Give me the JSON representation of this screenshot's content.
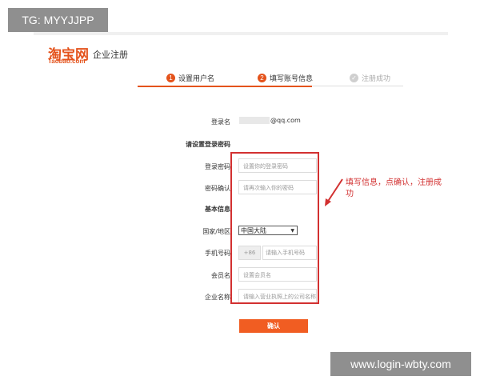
{
  "watermarks": {
    "top": "TG: MYYJJPP",
    "bottom": "www.login-wbty.com"
  },
  "header": {
    "logo_cn": "淘宝网",
    "logo_en": "Taobao.com",
    "subtitle": "企业注册"
  },
  "steps": [
    {
      "num": "1",
      "label": "设置用户名"
    },
    {
      "num": "2",
      "label": "填写账号信息"
    },
    {
      "num": "✓",
      "label": "注册成功"
    }
  ],
  "form": {
    "login_name_label": "登录名",
    "login_name_value": "@qq.com",
    "set_password_title": "请设置登录密码",
    "password_label": "登录密码",
    "password_placeholder": "设置你的登录密码",
    "confirm_label": "密码确认",
    "confirm_placeholder": "请再次输入你的密码",
    "basic_info_title": "基本信息",
    "country_label": "国家/地区",
    "country_value": "中国大陆",
    "phone_label": "手机号码",
    "phone_prefix": "+86",
    "phone_placeholder": "请输入手机号码",
    "member_label": "会员名",
    "member_placeholder": "设置会员名",
    "company_label": "企业名称",
    "company_placeholder": "请输入营业执照上的公司名称",
    "confirm_button": "确认"
  },
  "annotation": {
    "text": "填写信息，点确认，注册成功",
    "color": "#d23030"
  },
  "colors": {
    "brand": "#e4531c",
    "button": "#f15d22"
  }
}
